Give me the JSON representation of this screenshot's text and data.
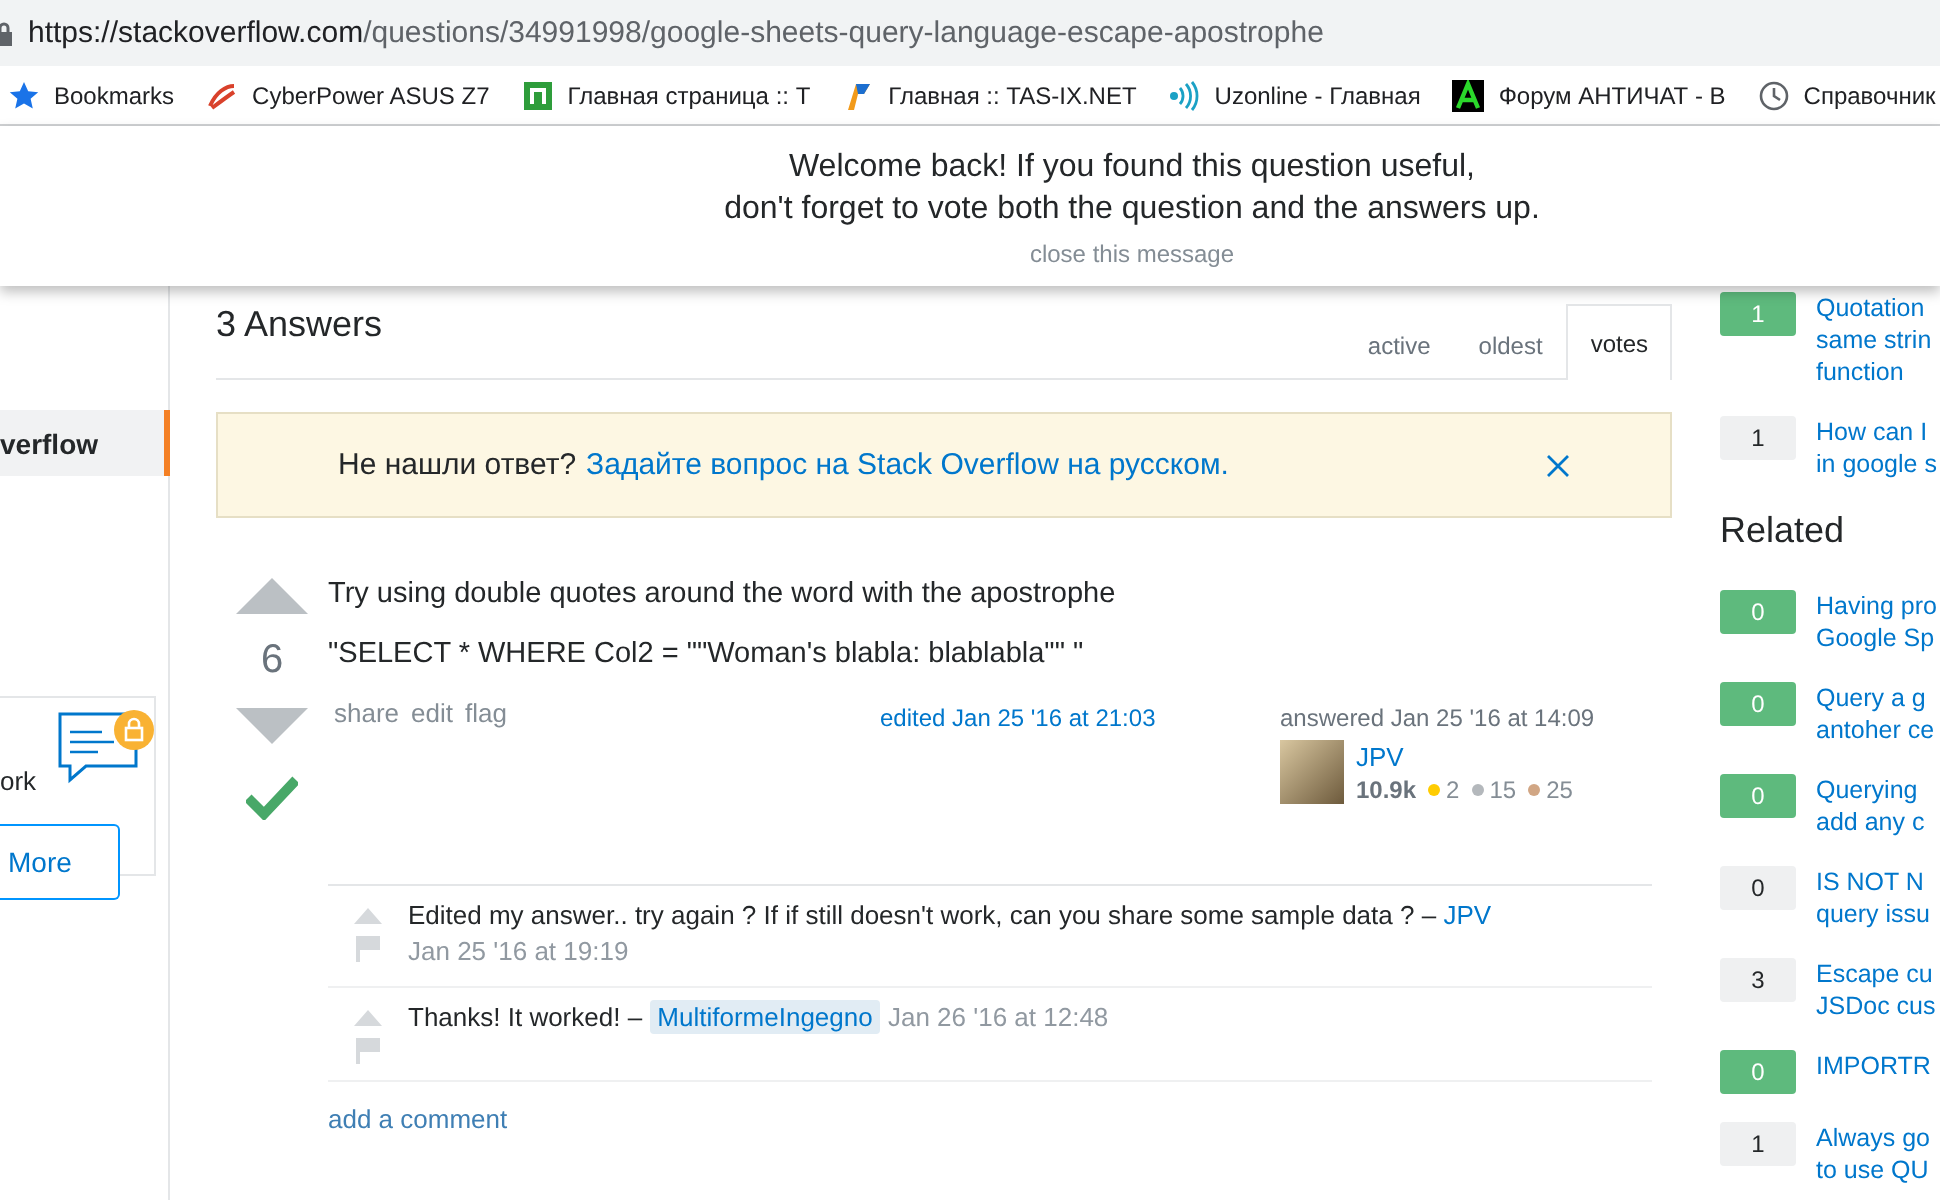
{
  "browser": {
    "url_host": "https://stackoverflow.com",
    "url_path": "/questions/34991998/google-sheets-query-language-escape-apostrophe",
    "bookmarks": [
      {
        "kind": "star",
        "label": "Bookmarks"
      },
      {
        "kind": "swirl",
        "label": "CyberPower ASUS Z7"
      },
      {
        "kind": "green-square",
        "label": "Главная страница :: T"
      },
      {
        "kind": "flag",
        "label": "Главная :: TAS-IX.NET"
      },
      {
        "kind": "waves",
        "label": "Uzonline - Главная"
      },
      {
        "kind": "letter",
        "label": "Форум АНТИЧАТ - В"
      },
      {
        "kind": "clock",
        "label": "Справочник"
      }
    ]
  },
  "banner": {
    "lines": [
      "Welcome back! If you found this question useful,",
      "don't forget to vote both the question and the answers up."
    ],
    "close": "close this message"
  },
  "left_nav": {
    "items": [
      {
        "label": "verflow",
        "selected": true
      }
    ],
    "card": {
      "text": "ork",
      "button": "More"
    }
  },
  "answers_header": {
    "title": "3 Answers",
    "tabs": [
      {
        "label": "active",
        "selected": false
      },
      {
        "label": "oldest",
        "selected": false
      },
      {
        "label": "votes",
        "selected": true
      }
    ]
  },
  "notice": {
    "question": "Не нашли ответ?",
    "link": "Задайте вопрос на Stack Overflow на русском."
  },
  "answer": {
    "votes": "6",
    "accepted": true,
    "paragraphs": [
      "Try using double quotes around the word with the apostrophe",
      "\"SELECT * WHERE Col2 = \"\"Woman's blabla: blablabla\"\" \""
    ],
    "actions": [
      "share",
      "edit",
      "flag"
    ],
    "edited": "edited Jan 25 '16 at 21:03",
    "answered": "answered Jan 25 '16 at 14:09",
    "user": {
      "name": "JPV",
      "reputation": "10.9k",
      "badges": [
        {
          "count": "2",
          "color": "#ffcc01"
        },
        {
          "count": "15",
          "color": "#b4b8bc"
        },
        {
          "count": "25",
          "color": "#d1a684"
        }
      ]
    },
    "comments": [
      {
        "text": "Edited my answer.. try again ? If if still doesn't work, can you share some sample data ? –",
        "author": "JPV",
        "author_is_op": false,
        "date": "Jan 25 '16 at 19:19"
      },
      {
        "text": "Thanks! It worked! –",
        "author": "MultiformeIngegno",
        "author_is_op": true,
        "date": "Jan 26 '16 at 12:48"
      }
    ],
    "add_comment": "add a comment"
  },
  "linked": [
    {
      "score": "1",
      "accepted": true,
      "lines": [
        "Quotation",
        "same strin",
        "function"
      ]
    },
    {
      "score": "1",
      "accepted": false,
      "lines": [
        "How can I",
        "in google s"
      ]
    }
  ],
  "related_title": "Related",
  "related": [
    {
      "score": "0",
      "accepted": true,
      "lines": [
        "Having pro",
        "Google Sp"
      ]
    },
    {
      "score": "0",
      "accepted": true,
      "lines": [
        "Query a g",
        "antoher ce"
      ]
    },
    {
      "score": "0",
      "accepted": true,
      "lines": [
        "Querying",
        "add any c"
      ]
    },
    {
      "score": "0",
      "accepted": false,
      "lines": [
        "IS NOT N",
        "query issu"
      ]
    },
    {
      "score": "3",
      "accepted": false,
      "lines": [
        "Escape cu",
        "JSDoc cus"
      ]
    },
    {
      "score": "0",
      "accepted": true,
      "lines": [
        "IMPORTR"
      ]
    },
    {
      "score": "1",
      "accepted": false,
      "lines": [
        "Always go",
        "to use QU"
      ]
    }
  ]
}
